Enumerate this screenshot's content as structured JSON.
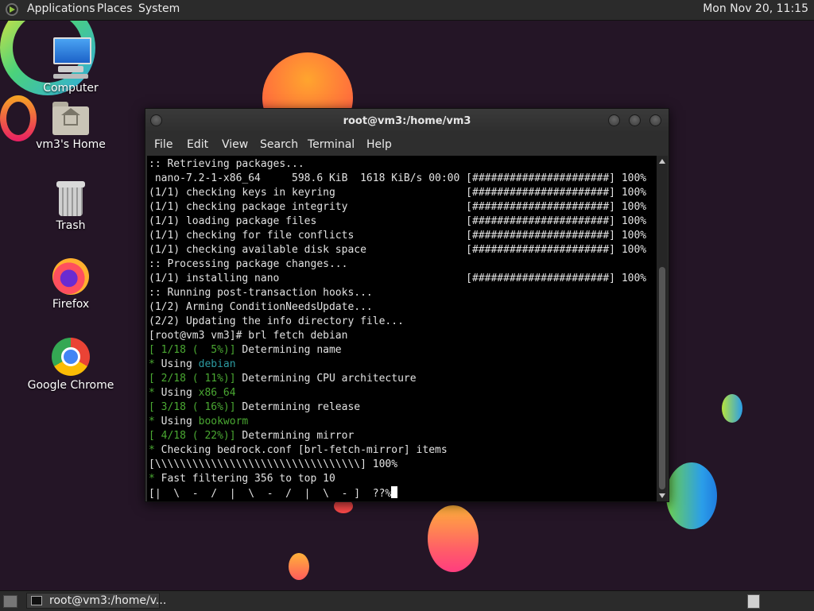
{
  "top_panel": {
    "menus": [
      "Applications",
      "Places",
      "System"
    ],
    "clock": "Mon Nov 20, 11:15"
  },
  "desktop": {
    "icons": [
      {
        "label": "Computer",
        "icon": "computer-icon"
      },
      {
        "label": "vm3's Home",
        "icon": "home-folder-icon"
      },
      {
        "label": "Trash",
        "icon": "trash-icon"
      },
      {
        "label": "Firefox",
        "icon": "firefox-icon"
      },
      {
        "label": "Google Chrome",
        "icon": "chrome-icon"
      }
    ]
  },
  "terminal": {
    "title": "root@vm3:/home/vm3",
    "menu": [
      "File",
      "Edit",
      "View",
      "Search",
      "Terminal",
      "Help"
    ],
    "lines": [
      {
        "parts": [
          {
            "t": ":: Retrieving packages..."
          }
        ]
      },
      {
        "parts": [
          {
            "t": " nano-7.2-1-x86_64     598.6 KiB  1618 KiB/s 00:00 [######################] 100%"
          }
        ]
      },
      {
        "parts": [
          {
            "t": "(1/1) checking keys in keyring                     [######################] 100%"
          }
        ]
      },
      {
        "parts": [
          {
            "t": "(1/1) checking package integrity                   [######################] 100%"
          }
        ]
      },
      {
        "parts": [
          {
            "t": "(1/1) loading package files                        [######################] 100%"
          }
        ]
      },
      {
        "parts": [
          {
            "t": "(1/1) checking for file conflicts                  [######################] 100%"
          }
        ]
      },
      {
        "parts": [
          {
            "t": "(1/1) checking available disk space                [######################] 100%"
          }
        ]
      },
      {
        "parts": [
          {
            "t": ":: Processing package changes..."
          }
        ]
      },
      {
        "parts": [
          {
            "t": "(1/1) installing nano                              [######################] 100%"
          }
        ]
      },
      {
        "parts": [
          {
            "t": ":: Running post-transaction hooks..."
          }
        ]
      },
      {
        "parts": [
          {
            "t": "(1/2) Arming ConditionNeedsUpdate..."
          }
        ]
      },
      {
        "parts": [
          {
            "t": "(2/2) Updating the info directory file..."
          }
        ]
      },
      {
        "parts": [
          {
            "t": "[root@vm3 vm3]# brl fetch debian"
          }
        ]
      },
      {
        "parts": [
          {
            "t": "[ 1/18 (  5%)]",
            "c": "green"
          },
          {
            "t": " Determining name"
          }
        ]
      },
      {
        "parts": [
          {
            "t": "*",
            "c": "green"
          },
          {
            "t": " Using "
          },
          {
            "t": "debian",
            "c": "blue"
          }
        ]
      },
      {
        "parts": [
          {
            "t": "[ 2/18 ( 11%)]",
            "c": "green"
          },
          {
            "t": " Determining CPU architecture"
          }
        ]
      },
      {
        "parts": [
          {
            "t": "*",
            "c": "green"
          },
          {
            "t": " Using "
          },
          {
            "t": "x86_64",
            "c": "green"
          }
        ]
      },
      {
        "parts": [
          {
            "t": "[ 3/18 ( 16%)]",
            "c": "green"
          },
          {
            "t": " Determining release"
          }
        ]
      },
      {
        "parts": [
          {
            "t": "*",
            "c": "green"
          },
          {
            "t": " Using "
          },
          {
            "t": "bookworm",
            "c": "green"
          }
        ]
      },
      {
        "parts": [
          {
            "t": "[ 4/18 ( 22%)]",
            "c": "green"
          },
          {
            "t": " Determining mirror"
          }
        ]
      },
      {
        "parts": [
          {
            "t": "*",
            "c": "green"
          },
          {
            "t": " Checking bedrock.conf [brl-fetch-mirror] items"
          }
        ]
      },
      {
        "parts": [
          {
            "t": "[\\\\\\\\\\\\\\\\\\\\\\\\\\\\\\\\\\\\\\\\\\\\\\\\\\\\\\\\\\\\\\\\\\] 100%"
          }
        ]
      },
      {
        "parts": [
          {
            "t": "*",
            "c": "green"
          },
          {
            "t": " Fast filtering 356 to top 10"
          }
        ]
      },
      {
        "parts": [
          {
            "t": "[|  \\  -  /  |  \\  -  /  |  \\  - ]  ??%"
          }
        ],
        "cursor": true
      }
    ]
  },
  "taskbar": {
    "task_label": "root@vm3:/home/v..."
  }
}
